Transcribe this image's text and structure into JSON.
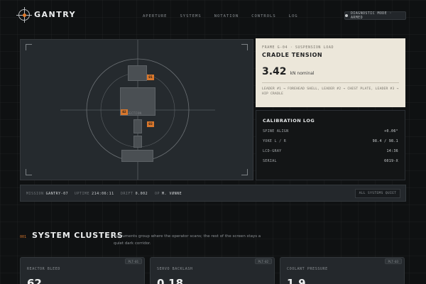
{
  "header": {
    "brand": "GANTRY",
    "nav": [
      "APERTURE",
      "SYSTEMS",
      "NOTATION",
      "CONTROLS",
      "LOG"
    ],
    "diagnostic": "DIAGNOSTIC MODE · ARMED"
  },
  "viewport": {
    "markers": [
      "01",
      "02",
      "03"
    ],
    "segment_label": "SECTION"
  },
  "cradle": {
    "eyebrow": "FRAME G-04 · SUSPENSION LOAD",
    "title": "CRADLE TENSION",
    "value": "3.42",
    "unit": "kN nominal",
    "note": "LEADER #1 → FOREHEAD SHELL, LEADER #2 → CHEST PLATE, LEADER #3 → HIP CRADLE"
  },
  "calibration": {
    "title": "CALIBRATION LOG",
    "rows": [
      {
        "label": "SPINE ALIGN",
        "value": "+0.06°"
      },
      {
        "label": "YOKE L / R",
        "value": "98.4 / 98.1"
      },
      {
        "label": "LCD-GRAY",
        "value": "14:36"
      },
      {
        "label": "SERIAL",
        "value": "6019-X"
      }
    ]
  },
  "mission": {
    "mission_label": "MISSION",
    "mission_value": "GANTRY-07",
    "uptime_label": "UPTIME",
    "uptime_value": "214:06:11",
    "drift_label": "DRIFT",
    "drift_value": "0.002",
    "op_label": "OP",
    "op_value": "M. VØNNE",
    "status_button": "ALL SYSTEMS QUIET"
  },
  "clusters": {
    "number": "001",
    "title": "SYSTEM CLUSTERS",
    "description": "Instruments group where the operator scans; the rest of the screen stays a quiet dark corridor.",
    "cards": [
      {
        "pill": "PLT-01",
        "label": "REACTOR BLEED",
        "value": "62"
      },
      {
        "pill": "PLT-02",
        "label": "SERVO BACKLASH",
        "value": "0.18"
      },
      {
        "pill": "PLT-03",
        "label": "COOLANT PRESSURE",
        "value": "1.9"
      }
    ]
  },
  "colors": {
    "accent": "#d9772c",
    "background": "#0f1112",
    "panel": "#24282c",
    "paper": "#ece7da"
  }
}
